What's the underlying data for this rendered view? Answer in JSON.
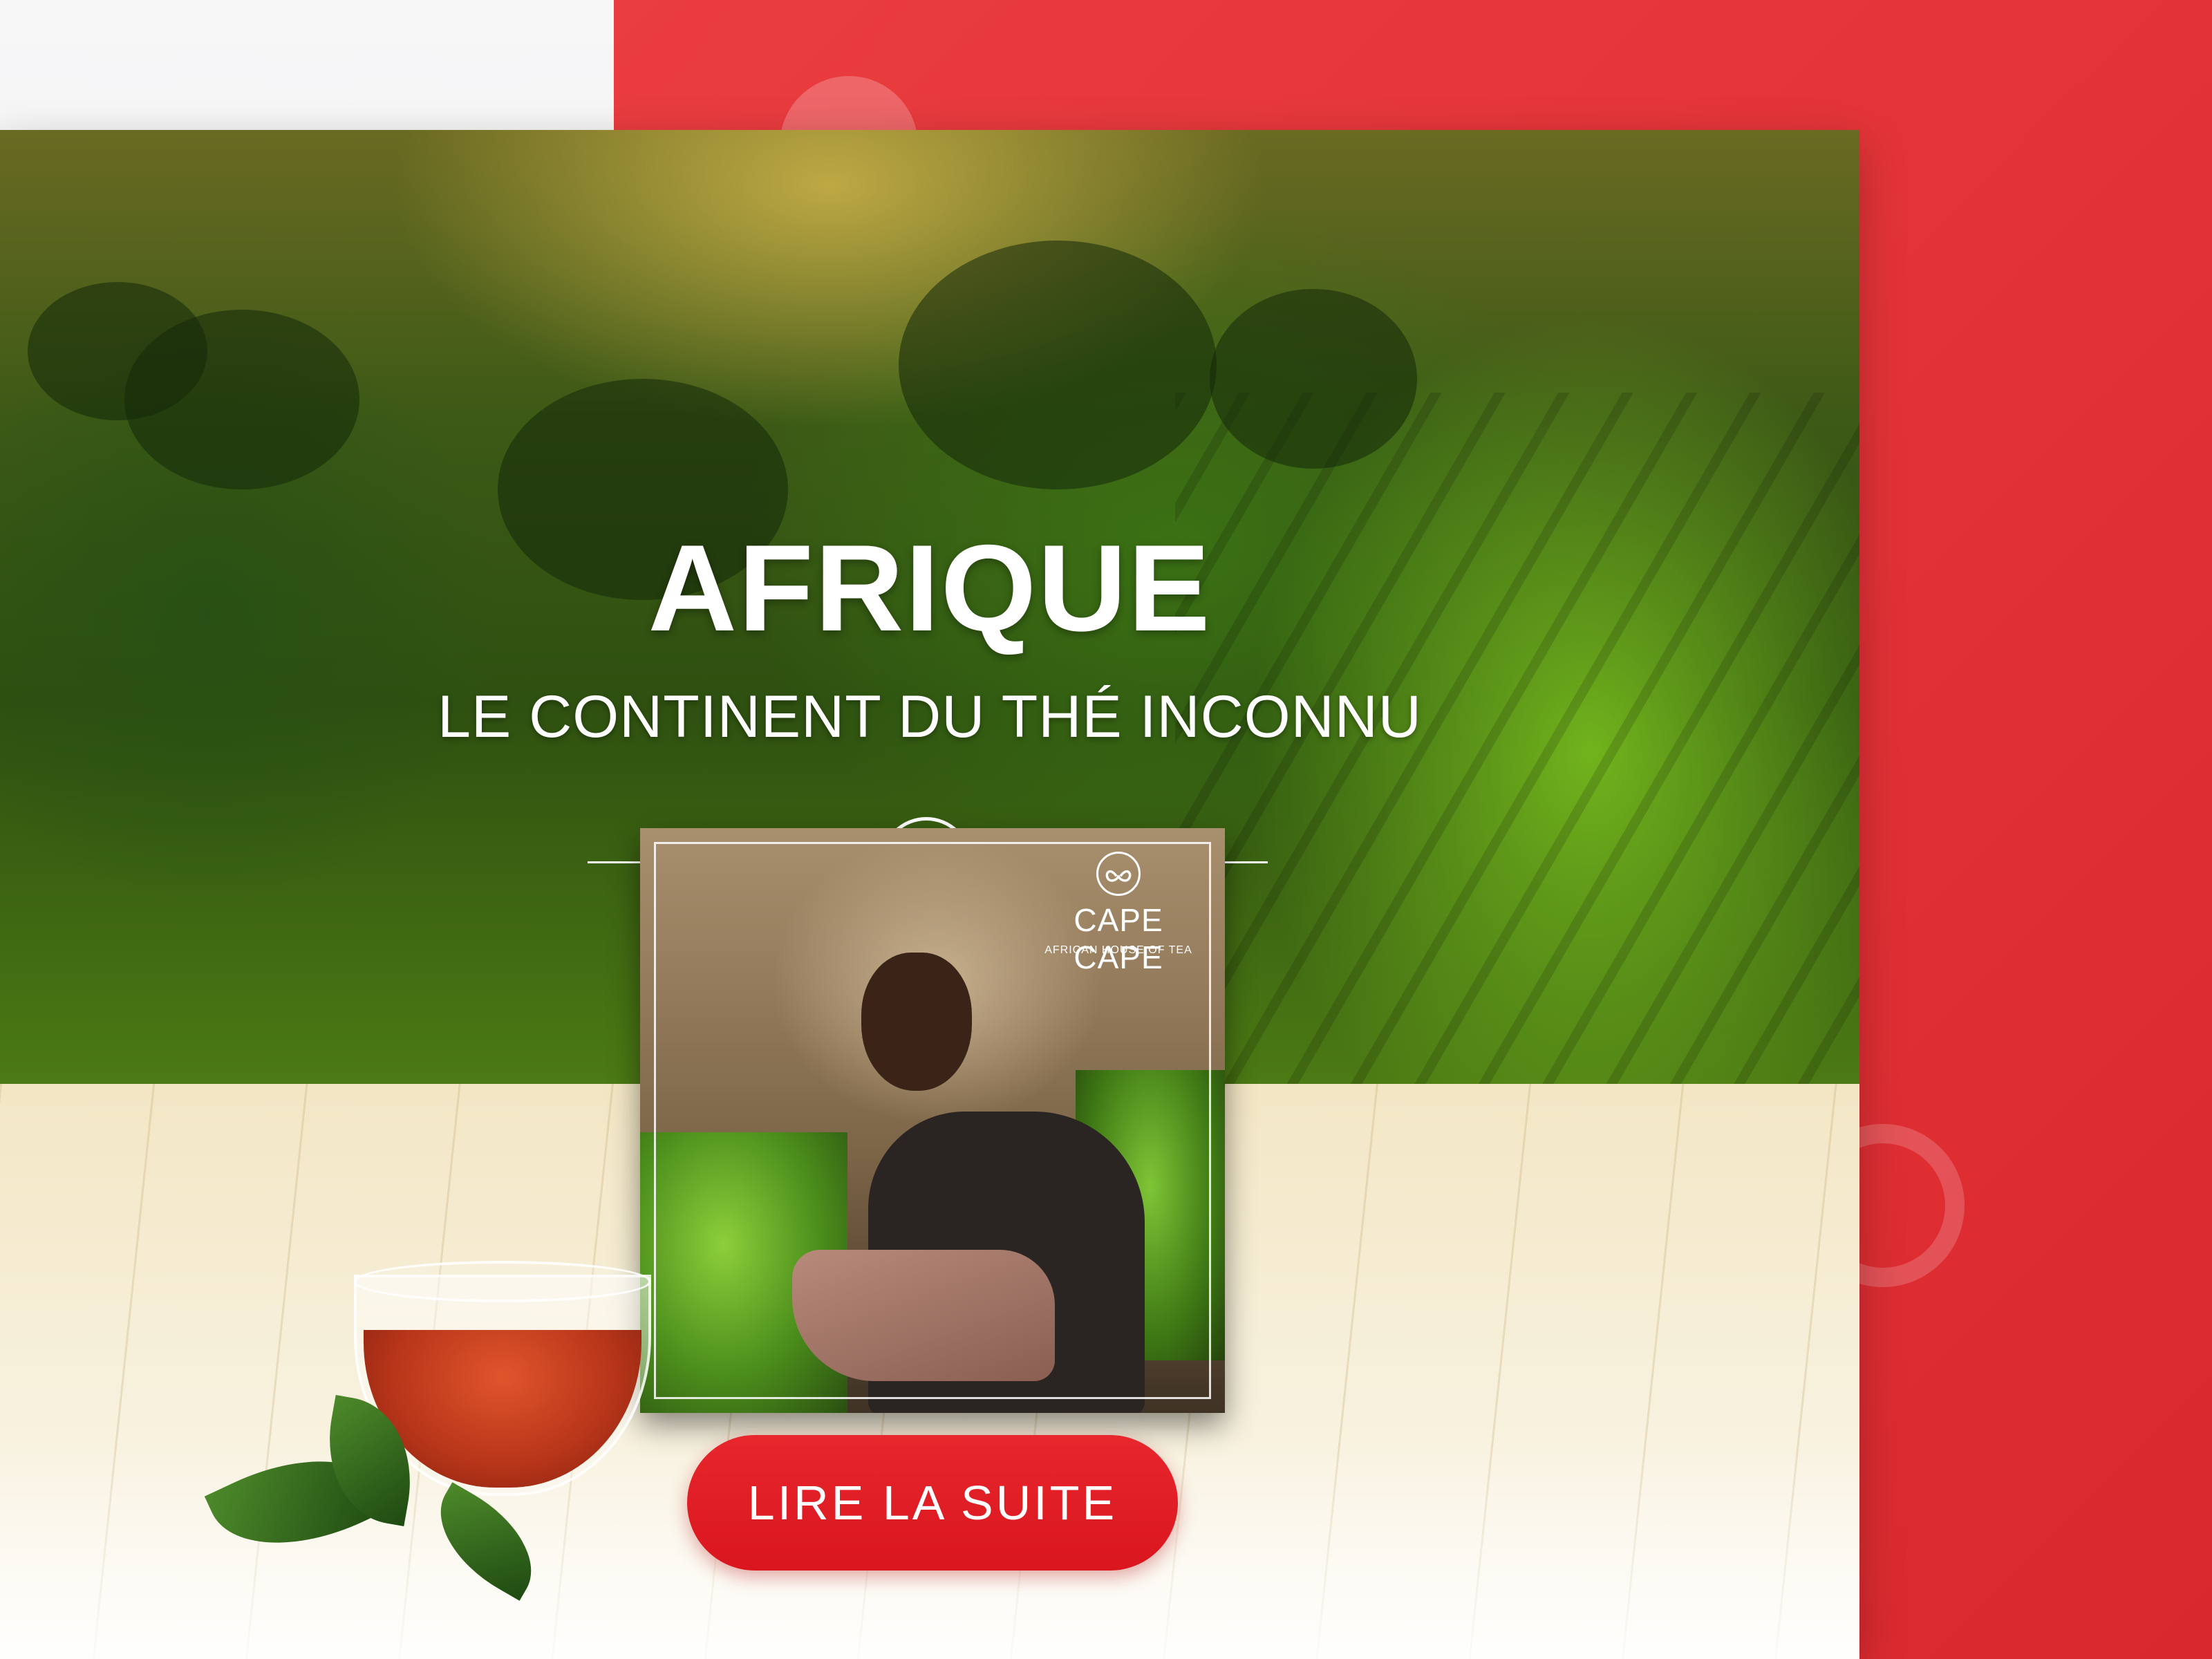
{
  "colors": {
    "accent_red": "#e32d31",
    "button_red": "#de1c23",
    "text_white": "#ffffff",
    "page_left_bg": "#f1f1f2"
  },
  "hero": {
    "title": "AFRIQUE",
    "subtitle": "LE CONTINENT DU THÉ INCONNU",
    "emblem_icon": "cape-and-cape-monogram-icon"
  },
  "product": {
    "brand_name": "CAPE CAPE",
    "brand_tagline": "AFRICAN HOUSE OF TEA",
    "logo_icon": "cape-and-cape-monogram-icon"
  },
  "cta": {
    "label": "LIRE LA SUITE"
  }
}
